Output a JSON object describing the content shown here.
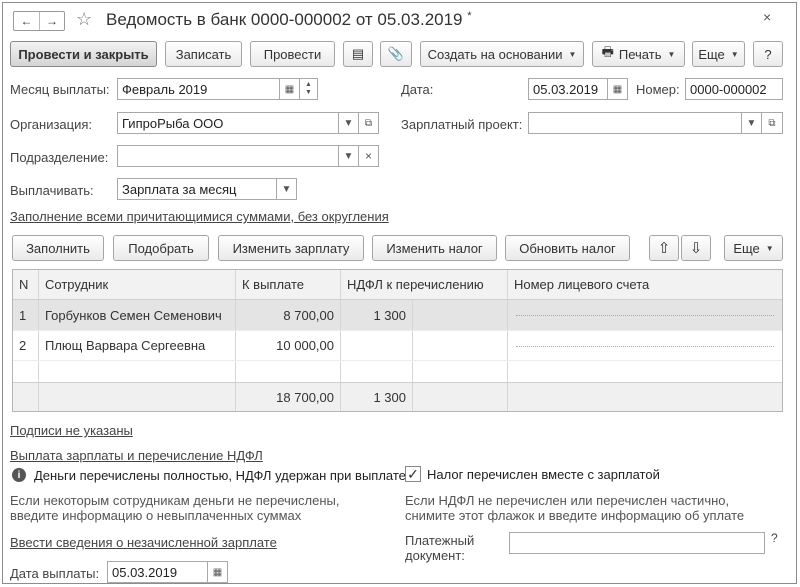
{
  "window": {
    "title": "Ведомость в банк 0000-000002 от 05.03.2019",
    "title_suffix": "*",
    "nav_back": "←",
    "nav_forward": "→",
    "star": "☆",
    "close": "×"
  },
  "toolbar": {
    "post_close": "Провести и закрыть",
    "save": "Записать",
    "post": "Провести",
    "report_icon": "▤",
    "attach_icon": "📎",
    "create_based": "Создать на основании",
    "print_icon": "🖶",
    "print": "Печать",
    "more": "Еще",
    "help": "?"
  },
  "form": {
    "month_label": "Месяц выплаты:",
    "month_value": "Февраль 2019",
    "date_label": "Дата:",
    "date_value": "05.03.2019",
    "number_label": "Номер:",
    "number_value": "0000-000002",
    "org_label": "Организация:",
    "org_value": "ГипроРыба ООО",
    "salary_project_label": "Зарплатный проект:",
    "salary_project_value": "",
    "division_label": "Подразделение:",
    "division_value": "",
    "pay_label": "Выплачивать:",
    "pay_value": "Зарплата за месяц",
    "fill_link": "Заполнение всеми причитающимися суммами, без округления"
  },
  "table_toolbar": {
    "fill": "Заполнить",
    "pick": "Подобрать",
    "change_salary": "Изменить зарплату",
    "change_tax": "Изменить налог",
    "update_tax": "Обновить налог",
    "up_icon": "⇧",
    "down_icon": "⇩",
    "more": "Еще"
  },
  "table": {
    "columns": [
      "N",
      "Сотрудник",
      "К выплате",
      "НДФЛ к перечислению",
      "Номер лицевого счета"
    ],
    "rows": [
      {
        "n": "1",
        "employee": "Горбунков Семен Семенович",
        "amount": "8 700,00",
        "tax": "1 300",
        "account": ""
      },
      {
        "n": "2",
        "employee": "Плющ Варвара Сергеевна",
        "amount": "10 000,00",
        "tax": "",
        "account": ""
      }
    ],
    "total_amount": "18 700,00",
    "total_tax": "1 300"
  },
  "bottom": {
    "signatures_link": "Подписи не указаны",
    "payment_link": "Выплата зарплаты и перечисление НДФЛ",
    "info_icon": "i",
    "info_text": "Деньги перечислены  полностью, НДФЛ удержан при выплате",
    "note_left_1": "Если некоторым сотрудникам деньги не перечислены,",
    "note_left_2": "введите информацию о невыплаченных суммах",
    "unpaid_link": "Ввести сведения о незачисленной зарплате",
    "pay_date_label": "Дата выплаты:",
    "pay_date_value": "05.03.2019",
    "tax_checkbox_label": "Налог перечислен вместе с зарплатой",
    "tax_checked_mark": "✓",
    "note_right_1": "Если НДФЛ не перечислен или перечислен частично,",
    "note_right_2": "снимите этот флажок и введите информацию об уплате",
    "payment_doc_label_1": "Платежный",
    "payment_doc_label_2": "документ:",
    "payment_doc_value": "",
    "help_mark": "?"
  }
}
